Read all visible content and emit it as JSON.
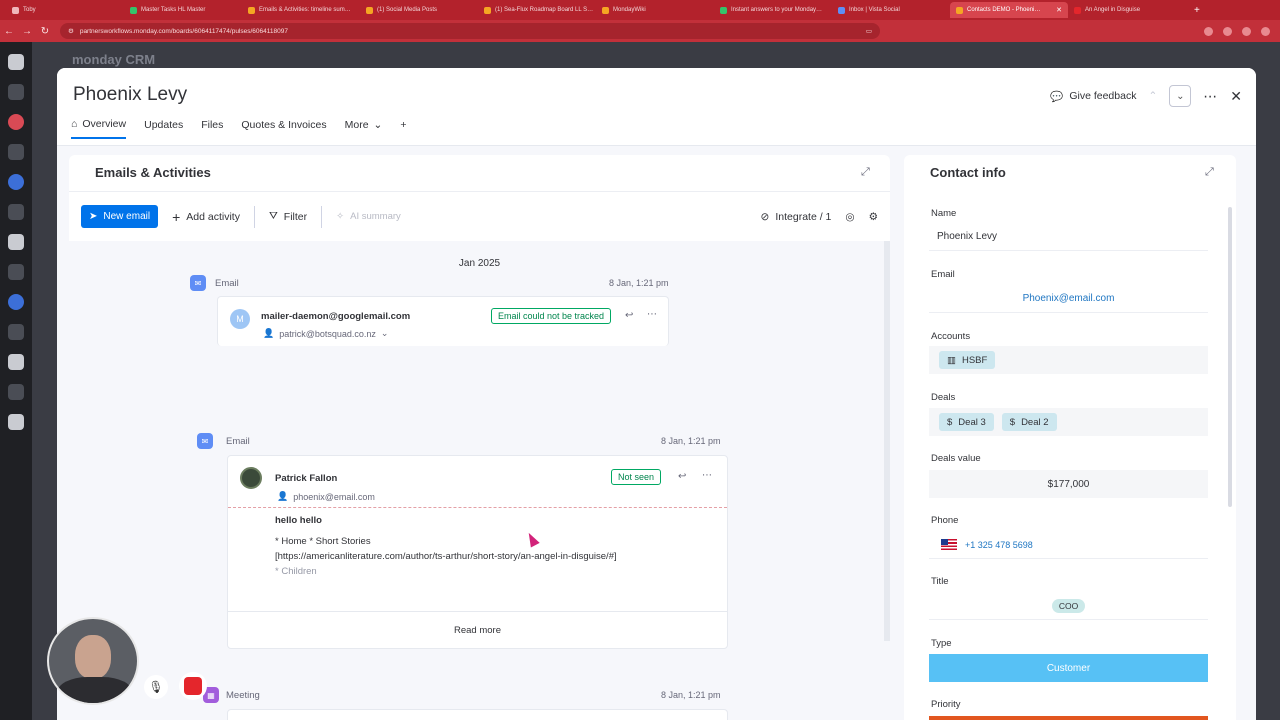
{
  "browser": {
    "tabs": [
      {
        "label": "Toby",
        "color": "#f0b7bb"
      },
      {
        "label": "Master Tasks HL Master",
        "color": "#35c46a"
      },
      {
        "label": "Emails & Activities: timeline sum…",
        "color": "#f5a623"
      },
      {
        "label": "(1) Social Media Posts",
        "color": "#f5a623"
      },
      {
        "label": "(1) Sea-Flux Roadmap Board LL S…",
        "color": "#f5a623"
      },
      {
        "label": "MondayWiki",
        "color": "#f5a623"
      },
      {
        "label": "Instant answers to your Monday…",
        "color": "#35c46a"
      },
      {
        "label": "Inbox | Vista Social",
        "color": "#5f8df5"
      },
      {
        "label": "Contacts DEMO - Phoeni…",
        "color": "#f5a623",
        "active": true
      },
      {
        "label": "An Angel in Disguise",
        "color": "#e4262c"
      }
    ],
    "url": "partnersworkflows.monday.com/boards/6064117474/pulses/6064118097"
  },
  "app": {
    "logo": "monday CRM"
  },
  "item": {
    "title": "Phoenix Levy",
    "tabs": [
      "Overview",
      "Updates",
      "Files",
      "Quotes & Invoices",
      "More"
    ],
    "add_tab": "+",
    "give_feedback": "Give feedback"
  },
  "activities": {
    "title": "Emails & Activities",
    "toolbar": {
      "new_email": "New email",
      "add_activity": "Add activity",
      "filter": "Filter",
      "ai_summary": "AI summary",
      "integrate": "Integrate / 1"
    },
    "month": "Jan 2025",
    "entries": [
      {
        "type": "Email",
        "time": "8 Jan, 1:21 pm",
        "sender": "mailer-daemon@googlemail.com",
        "avatar_letter": "M",
        "recipient": "patrick@botsquad.co.nz",
        "status": "Email could not be tracked"
      },
      {
        "type": "Email",
        "time": "8 Jan, 1:21 pm",
        "sender": "Patrick Fallon",
        "recipient": "phoenix@email.com",
        "status": "Not seen",
        "subject": "hello hello",
        "body_lines": [
          "* Home * Short Stories",
          "[https://americanliterature.com/author/ts-arthur/short-story/an-angel-in-disguise/#]",
          "* Children"
        ],
        "read_more": "Read more"
      },
      {
        "type": "Meeting",
        "time": "8 Jan, 1:21 pm"
      }
    ]
  },
  "contact": {
    "title": "Contact info",
    "name_label": "Name",
    "name": "Phoenix Levy",
    "email_label": "Email",
    "email": "Phoenix@email.com",
    "accounts_label": "Accounts",
    "account": "HSBF",
    "deals_label": "Deals",
    "deals": [
      "Deal 3",
      "Deal 2"
    ],
    "deals_value_label": "Deals value",
    "deals_value": "$177,000",
    "phone_label": "Phone",
    "phone": "+1 325 478 5698",
    "title_label": "Title",
    "job_title": "COO",
    "type_label": "Type",
    "type": "Customer",
    "type_color": "#57c1f5",
    "priority_label": "Priority",
    "priority_color": "#e2561f"
  },
  "colors": {
    "accent": "#0073ea",
    "chrome": "#b3222c"
  }
}
